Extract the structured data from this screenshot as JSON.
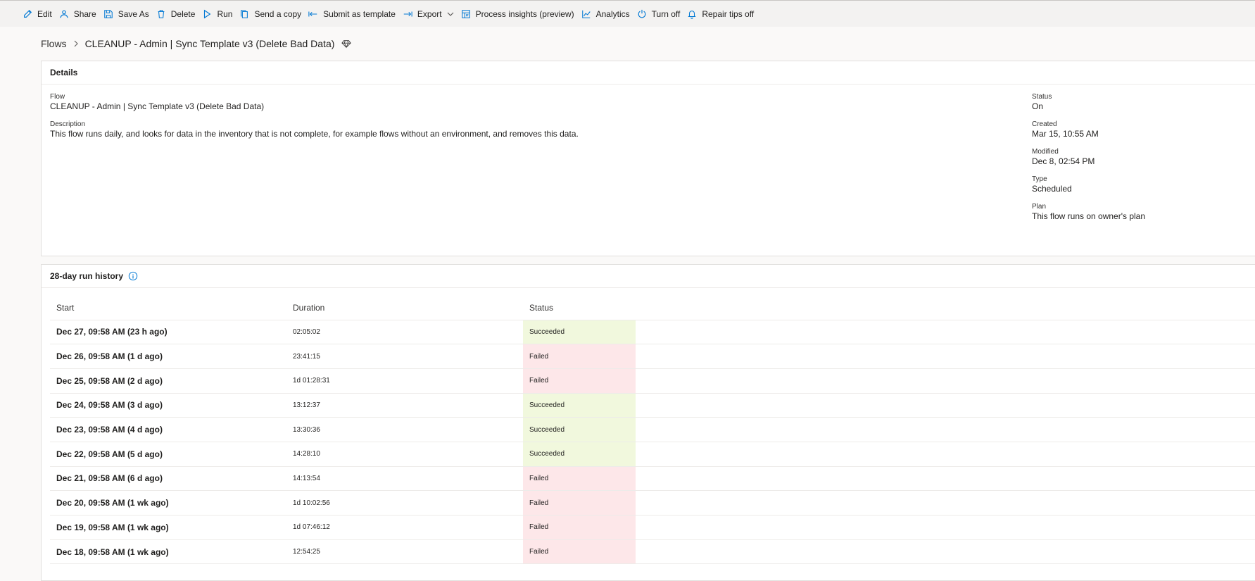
{
  "commands": [
    {
      "label": "Edit",
      "icon": "edit-icon"
    },
    {
      "label": "Share",
      "icon": "share-icon"
    },
    {
      "label": "Save As",
      "icon": "save-as-icon"
    },
    {
      "label": "Delete",
      "icon": "delete-icon"
    },
    {
      "label": "Run",
      "icon": "run-icon"
    },
    {
      "label": "Send a copy",
      "icon": "send-copy-icon"
    },
    {
      "label": "Submit as template",
      "icon": "submit-template-icon"
    },
    {
      "label": "Export",
      "icon": "export-icon"
    },
    {
      "label": "Process insights (preview)",
      "icon": "process-insights-icon"
    },
    {
      "label": "Analytics",
      "icon": "analytics-icon"
    },
    {
      "label": "Turn off",
      "icon": "power-icon"
    },
    {
      "label": "Repair tips off",
      "icon": "bell-icon"
    }
  ],
  "breadcrumb": {
    "root": "Flows",
    "title": "CLEANUP - Admin | Sync Template v3 (Delete Bad Data)"
  },
  "details": {
    "heading": "Details",
    "flow_label": "Flow",
    "flow_value": "CLEANUP - Admin | Sync Template v3 (Delete Bad Data)",
    "description_label": "Description",
    "description_value": "This flow runs daily, and looks for data in the inventory that is not complete, for example flows without an environment, and removes this data.",
    "status_label": "Status",
    "status_value": "On",
    "created_label": "Created",
    "created_value": "Mar 15, 10:55 AM",
    "modified_label": "Modified",
    "modified_value": "Dec 8, 02:54 PM",
    "type_label": "Type",
    "type_value": "Scheduled",
    "plan_label": "Plan",
    "plan_value": "This flow runs on owner's plan"
  },
  "run_history": {
    "heading": "28-day run history",
    "columns": {
      "start": "Start",
      "duration": "Duration",
      "status": "Status"
    },
    "rows": [
      {
        "start": "Dec 27, 09:58 AM (23 h ago)",
        "duration": "02:05:02",
        "status": "Succeeded"
      },
      {
        "start": "Dec 26, 09:58 AM (1 d ago)",
        "duration": "23:41:15",
        "status": "Failed"
      },
      {
        "start": "Dec 25, 09:58 AM (2 d ago)",
        "duration": "1d 01:28:31",
        "status": "Failed"
      },
      {
        "start": "Dec 24, 09:58 AM (3 d ago)",
        "duration": "13:12:37",
        "status": "Succeeded"
      },
      {
        "start": "Dec 23, 09:58 AM (4 d ago)",
        "duration": "13:30:36",
        "status": "Succeeded"
      },
      {
        "start": "Dec 22, 09:58 AM (5 d ago)",
        "duration": "14:28:10",
        "status": "Succeeded"
      },
      {
        "start": "Dec 21, 09:58 AM (6 d ago)",
        "duration": "14:13:54",
        "status": "Failed"
      },
      {
        "start": "Dec 20, 09:58 AM (1 wk ago)",
        "duration": "1d 10:02:56",
        "status": "Failed"
      },
      {
        "start": "Dec 19, 09:58 AM (1 wk ago)",
        "duration": "1d 07:46:12",
        "status": "Failed"
      },
      {
        "start": "Dec 18, 09:58 AM (1 wk ago)",
        "duration": "12:54:25",
        "status": "Failed"
      }
    ]
  },
  "colors": {
    "accent": "#0078d4",
    "succeeded_bg": "#f1f8dd",
    "failed_bg": "#fde7e9"
  }
}
